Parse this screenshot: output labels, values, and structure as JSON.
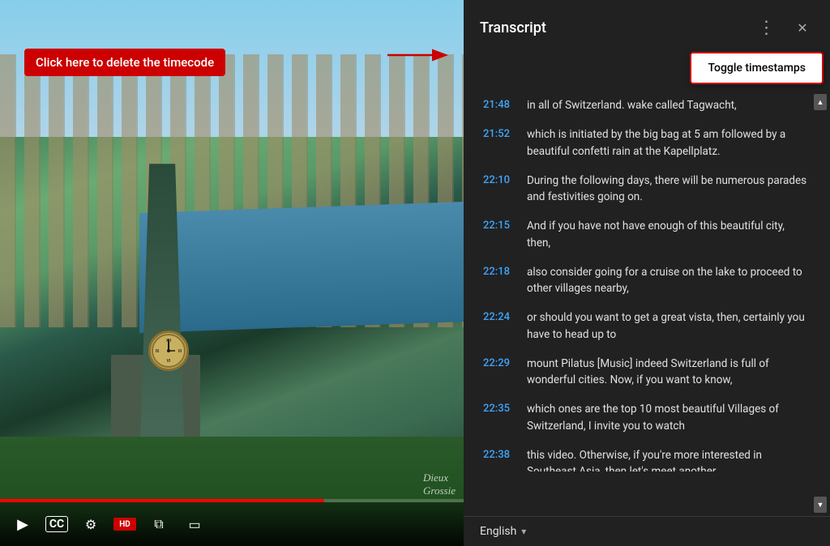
{
  "video": {
    "annotation_text": "Click here to delete the timecode",
    "watermark": "Dieux\nGrossie",
    "controls": {
      "play_icon": "▶",
      "subtitles_icon": "CC",
      "settings_icon": "⚙",
      "hd_badge": "HD",
      "miniplayer_icon": "⧉",
      "theater_icon": "▭"
    }
  },
  "transcript": {
    "title": "Transcript",
    "toggle_label": "Toggle timestamps",
    "entries": [
      {
        "time": "21:48",
        "text": "in all of Switzerland. wake called Tagwacht,"
      },
      {
        "time": "21:52",
        "text": "which is initiated by the big bag at 5 am followed  by a beautiful confetti rain at the Kapellplatz."
      },
      {
        "time": "22:10",
        "text": "During the following days, there will be  numerous parades and festivities going on."
      },
      {
        "time": "22:15",
        "text": "And if you have not have enough  of this beautiful city, then,"
      },
      {
        "time": "22:18",
        "text": "also consider going for a cruise on the  lake to proceed to other villages nearby,"
      },
      {
        "time": "22:24",
        "text": "or should you want to get a great vista,  then, certainly you have to head up to"
      },
      {
        "time": "22:29",
        "text": "mount Pilatus [Music] indeed Switzerland is full  of wonderful cities. Now, if you want to know,"
      },
      {
        "time": "22:35",
        "text": "which ones are the top 10 most beautiful  Villages of Switzerland, I invite you to watch"
      },
      {
        "time": "22:38",
        "text": "this video. Otherwise, if you're more interested  in Southeast Asia, then let's meet another..."
      }
    ],
    "language": "English",
    "more_options_icon": "⋮",
    "close_icon": "✕"
  }
}
